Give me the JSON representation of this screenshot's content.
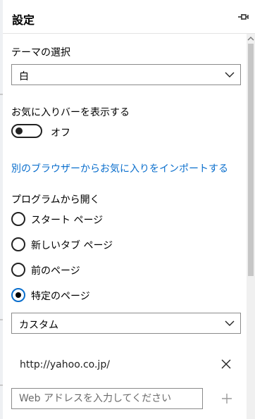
{
  "header": {
    "title": "設定"
  },
  "theme": {
    "label": "テーマの選択",
    "value": "白"
  },
  "favorites_bar": {
    "label": "お気に入りバーを表示する",
    "state_text": "オフ",
    "on": false
  },
  "import_link": "別のブラウザーからお気に入りをインポートする",
  "open_with": {
    "label": "プログラムから開く",
    "options": [
      {
        "label": "スタート ページ",
        "checked": false
      },
      {
        "label": "新しいタブ ページ",
        "checked": false
      },
      {
        "label": "前のページ",
        "checked": false
      },
      {
        "label": "特定のページ",
        "checked": true
      }
    ],
    "page_select": "カスタム",
    "pages": [
      "http://yahoo.co.jp/"
    ],
    "address_placeholder": "Web アドレスを入力してください"
  },
  "colors": {
    "accent": "#0b6fcd"
  }
}
